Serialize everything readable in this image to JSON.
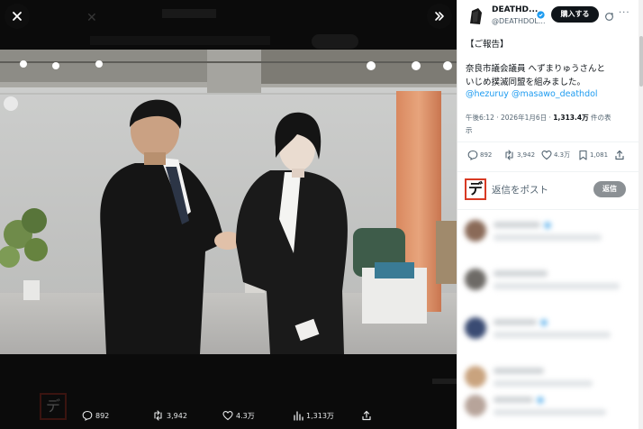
{
  "viewer": {
    "close_icon": "close-icon",
    "expand_icon": "expand-icon",
    "actions": [
      {
        "icon": "reply-icon",
        "count": "892"
      },
      {
        "icon": "repost-icon",
        "count": "3,942"
      },
      {
        "icon": "like-icon",
        "count": "4.3万"
      },
      {
        "icon": "views-icon",
        "count": "1,313万"
      },
      {
        "icon": "share-icon",
        "count": ""
      }
    ]
  },
  "post": {
    "author_name": "DEATHD...",
    "handle": "@DEATHDOL...",
    "buy_label": "購入する",
    "text_line1": "【ご報告】",
    "text_line2": "奈良市議会議員 へずまりゅうさんと",
    "text_line3": "いじめ撲滅同盟を組みました。",
    "mentions": "@hezuruy @masawo_deathdol",
    "meta_time": "午後6:12 · 2026年1月6日 · ",
    "meta_views_number": "1,313.4万",
    "meta_views_label": " 件の表",
    "meta_views_label2": "示",
    "actions": [
      {
        "icon": "reply-icon",
        "count": "892"
      },
      {
        "icon": "repost-icon",
        "count": "3,942"
      },
      {
        "icon": "like-icon",
        "count": "4.3万"
      },
      {
        "icon": "bookmark-icon",
        "count": "1,081"
      },
      {
        "icon": "share-icon",
        "count": ""
      }
    ],
    "reply_avatar_glyph": "デ",
    "reply_placeholder": "返信をポスト",
    "reply_button": "返信"
  },
  "colors": {
    "link": "#1d9bf0",
    "reply_avatar_border": "#d83a24",
    "buy_button": "#0f1419",
    "reply_button_disabled": "#8b9094"
  }
}
